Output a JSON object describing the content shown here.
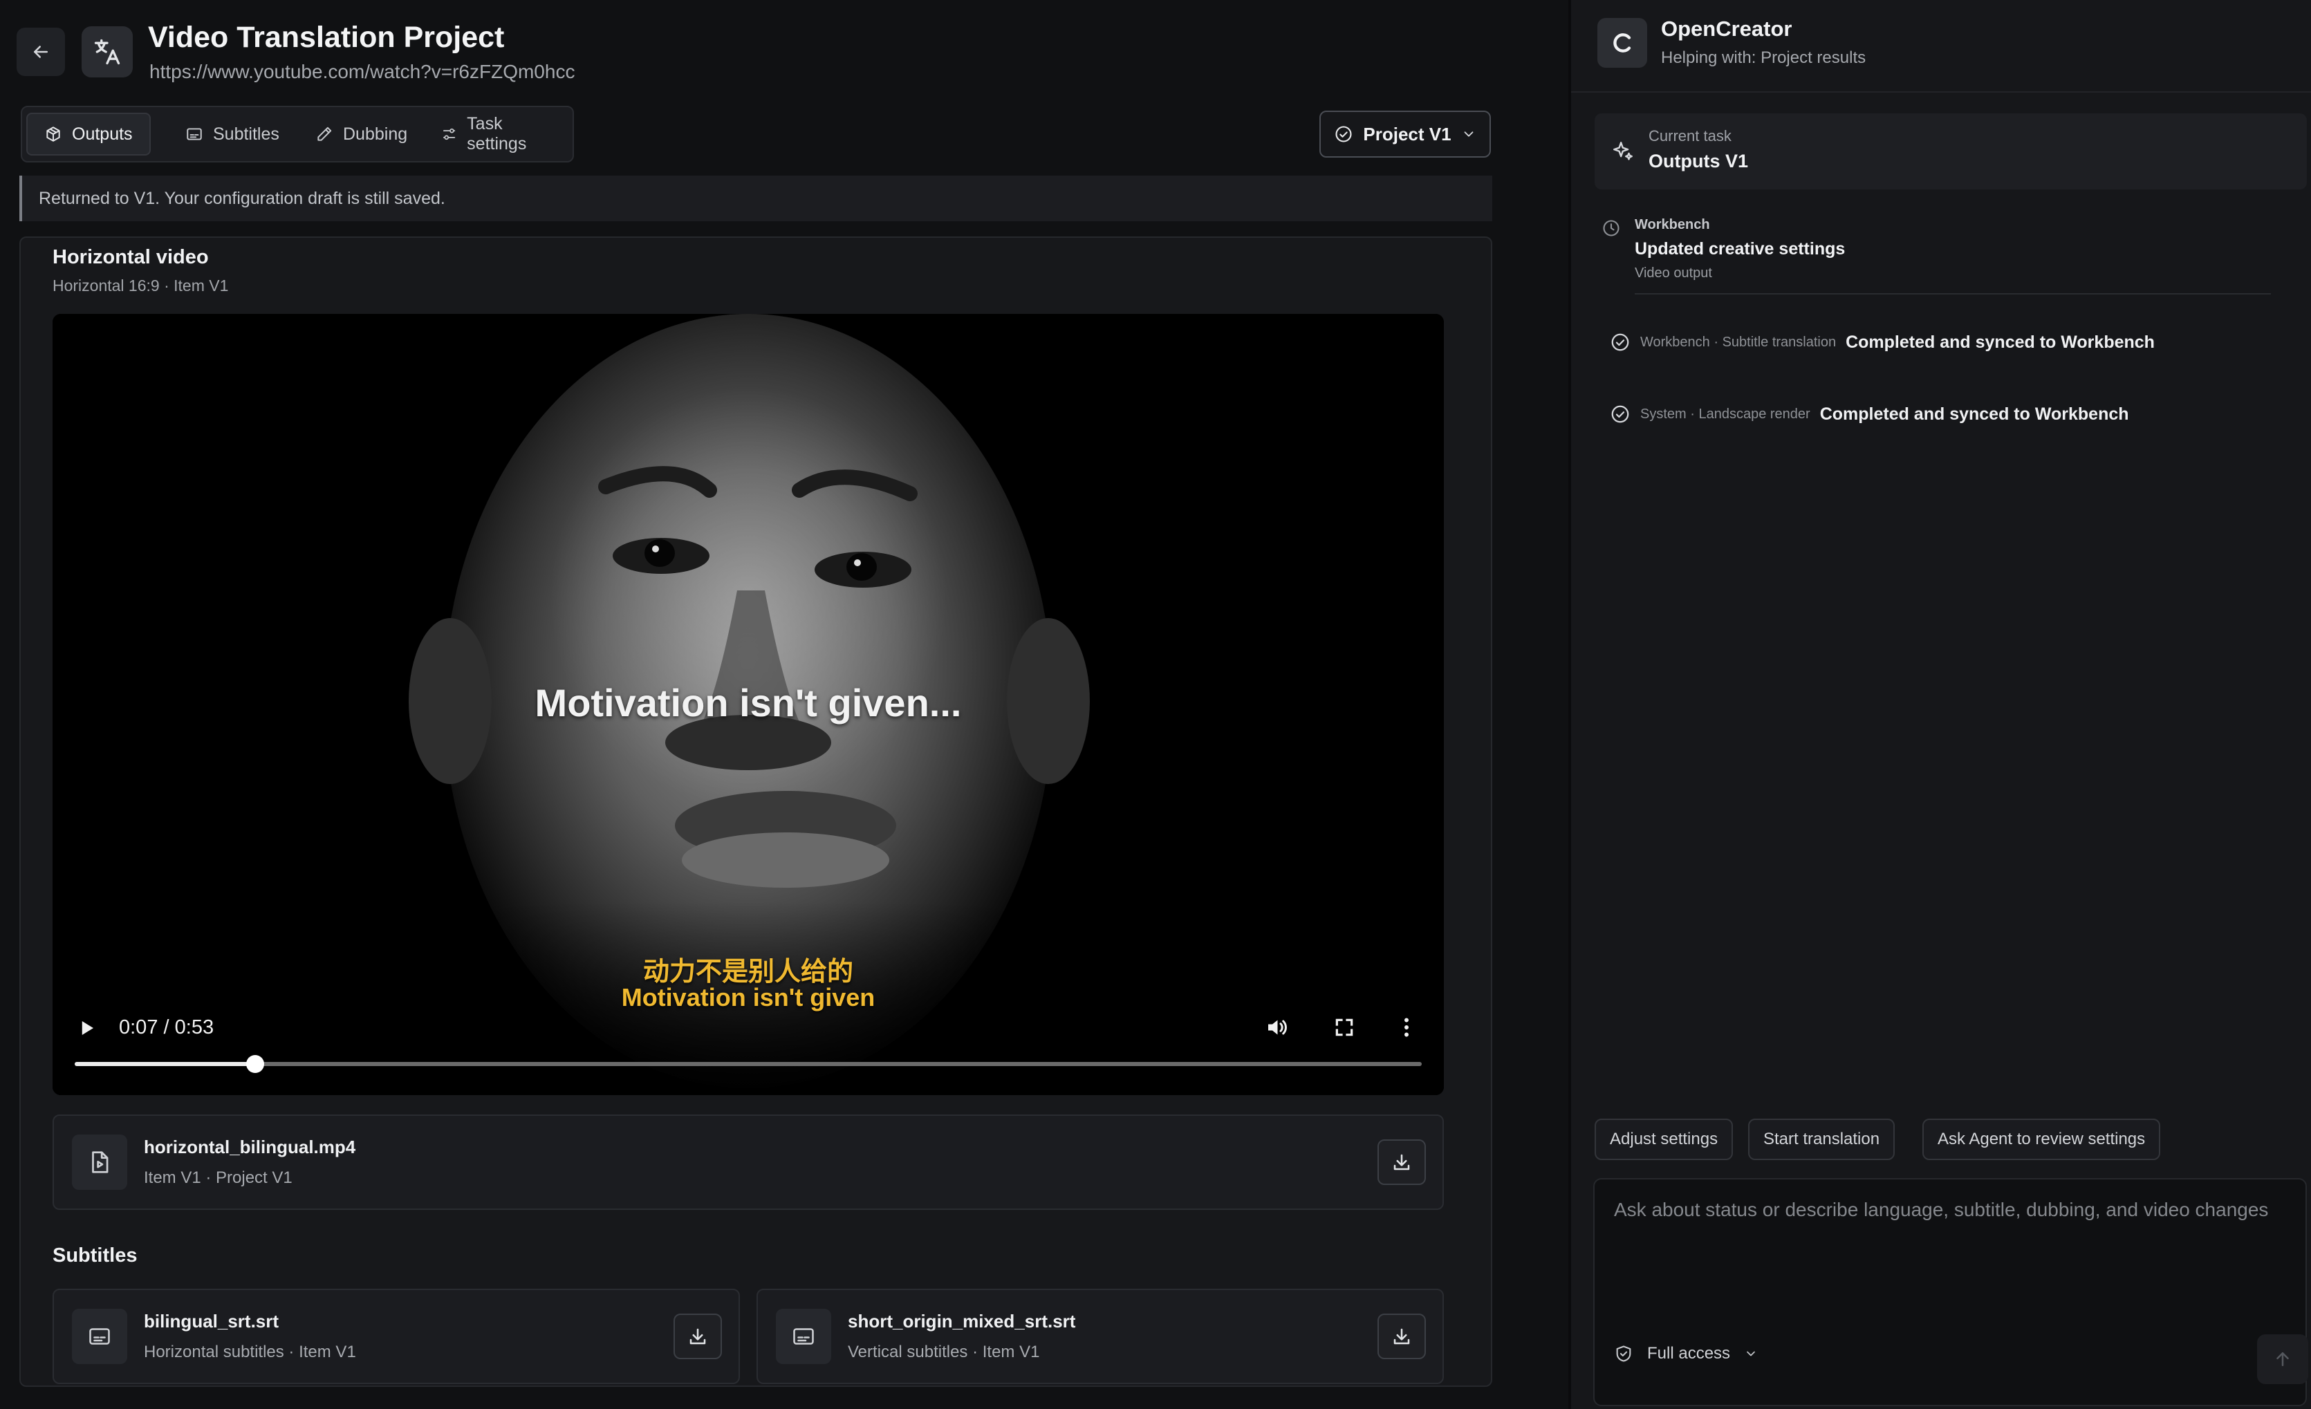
{
  "header": {
    "title": "Video Translation Project",
    "url": "https://www.youtube.com/watch?v=r6zFZQm0hcc"
  },
  "tabs": [
    {
      "label": "Outputs",
      "icon": "box-icon",
      "active": true
    },
    {
      "label": "Subtitles",
      "icon": "subtitles-icon",
      "active": false
    },
    {
      "label": "Dubbing",
      "icon": "pen-icon",
      "active": false
    },
    {
      "label": "Task settings",
      "icon": "sliders-icon",
      "active": false
    }
  ],
  "version_selector": {
    "label": "Project V1"
  },
  "notice": "Returned to V1. Your configuration draft is still saved.",
  "horizontal_video": {
    "title": "Horizontal video",
    "subtitle": "Horizontal 16:9 · Item V1",
    "overlay_caption": "Motivation isn't given...",
    "subtitle_cn": "动力不是别人给的",
    "subtitle_en": "Motivation isn't given",
    "current_time": "0:07",
    "time_separator": "/",
    "duration": "0:53",
    "progress": 0.134
  },
  "video_file": {
    "name": "horizontal_bilingual.mp4",
    "meta": "Item V1 · Project V1"
  },
  "subtitles_section": {
    "title": "Subtitles",
    "files": [
      {
        "name": "bilingual_srt.srt",
        "meta": "Horizontal subtitles · Item V1"
      },
      {
        "name": "short_origin_mixed_srt.srt",
        "meta": "Vertical subtitles · Item V1"
      }
    ]
  },
  "agent": {
    "name": "OpenCreator",
    "helping": "Helping with: Project results"
  },
  "current_task": {
    "label": "Current task",
    "value": "Outputs V1"
  },
  "workbench": {
    "label": "Workbench",
    "title": "Updated creative settings",
    "meta": "Video output"
  },
  "events": [
    {
      "source": "Workbench · Subtitle translation",
      "text": "Completed and synced to Workbench"
    },
    {
      "source": "System · Landscape render",
      "text": "Completed and synced to Workbench"
    }
  ],
  "suggestions": [
    "Adjust settings",
    "Start translation",
    "Ask Agent to review settings"
  ],
  "composer": {
    "placeholder": "Ask about status or describe language, subtitle, dubbing, and video changes",
    "access_label": "Full access"
  },
  "colors": {
    "background": "#101113",
    "panel": "#17181b",
    "subtitle_yellow": "#f0b930",
    "text_primary": "#f2f3f5",
    "text_muted": "#a6a9ae"
  }
}
